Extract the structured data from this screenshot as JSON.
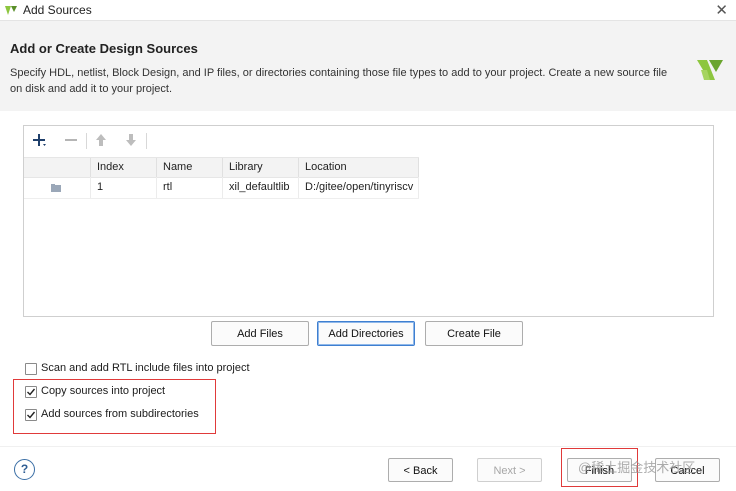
{
  "window": {
    "title": "Add Sources"
  },
  "header": {
    "title": "Add or Create Design Sources",
    "description": "Specify HDL, netlist, Block Design, and IP files, or directories containing those file types to add to your project. Create a new source file on disk and add it to your project."
  },
  "table": {
    "columns": [
      "Index",
      "Name",
      "Library",
      "Location"
    ],
    "rows": [
      {
        "index": "1",
        "name": "rtl",
        "library": "xil_defaultlib",
        "location": "D:/gitee/open/tinyriscv"
      }
    ]
  },
  "actions": {
    "add_files": "Add Files",
    "add_directories": "Add Directories",
    "create_file": "Create File"
  },
  "options": {
    "scan_rtl": "Scan and add RTL include files into project",
    "copy_sources": "Copy sources into project",
    "add_subdirs": "Add sources from subdirectories"
  },
  "footer": {
    "help": "?",
    "back": "< Back",
    "next": "Next >",
    "finish": "Finish",
    "cancel": "Cancel"
  },
  "watermark": "@稀土掘金技术社区",
  "colors": {
    "accent": "#3f7fd0",
    "highlight": "#e03a3a",
    "logo": "#8dc63f"
  }
}
